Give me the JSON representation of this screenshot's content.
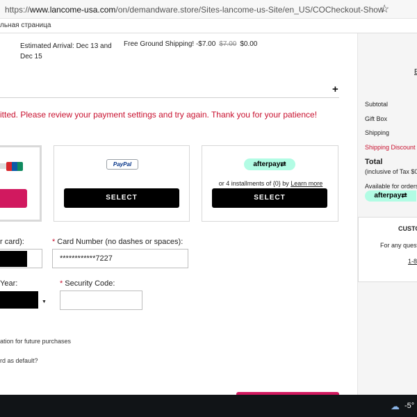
{
  "browser": {
    "url_prefix": "https://",
    "url_host": "www.lancome-usa.com",
    "url_path": "/on/demandware.store/Sites-lancome-us-Site/en_US/COCheckout-Show",
    "bookmark_label": "льная страница",
    "star_icon": "star-icon"
  },
  "shipping": {
    "arrival_text": "Estimated Arrival: Dec 13 and Dec 15",
    "method_label": "Free Ground Shipping! -$7.00",
    "old_price": "$7.00",
    "new_price": "$0.00",
    "plus": "+"
  },
  "error_message": "itted. Please review your payment settings and try again. Thank you for your patience!",
  "payment": {
    "paypal_logo": "PayPal",
    "afterpay_logo": "afterpay⇄",
    "afterpay_installments_text": "or 4 installments of {0} by ",
    "afterpay_learn_more": "Learn more",
    "select_label": "SELECT"
  },
  "form": {
    "name_label": "r card):",
    "card_number_label": "Card Number (no dashes or spaces):",
    "card_number_value": "************7227",
    "year_label": "Year:",
    "security_code_label": "Security Code:",
    "required_mark": "*",
    "save_info_text": "ation for future purchases",
    "default_card_text": "rd as default?"
  },
  "summary": {
    "link_fragment": "E",
    "subtotal": "Subtotal",
    "gift_box": "Gift Box",
    "shipping": "Shipping",
    "shipping_discount": "Shipping Discount",
    "total": "Total",
    "tax_note": "(inclusive of Tax $0",
    "available_orders": "Available for orders",
    "afterpay_logo": "afterpay⇄"
  },
  "customer_service": {
    "title": "CUSTO",
    "question": "For any quest",
    "phone": "1-8"
  },
  "taskbar": {
    "temperature": "-5°"
  },
  "colors": {
    "accent_pink": "#d1195f",
    "error_red": "#c8102e",
    "afterpay_mint": "#b2fce4"
  }
}
